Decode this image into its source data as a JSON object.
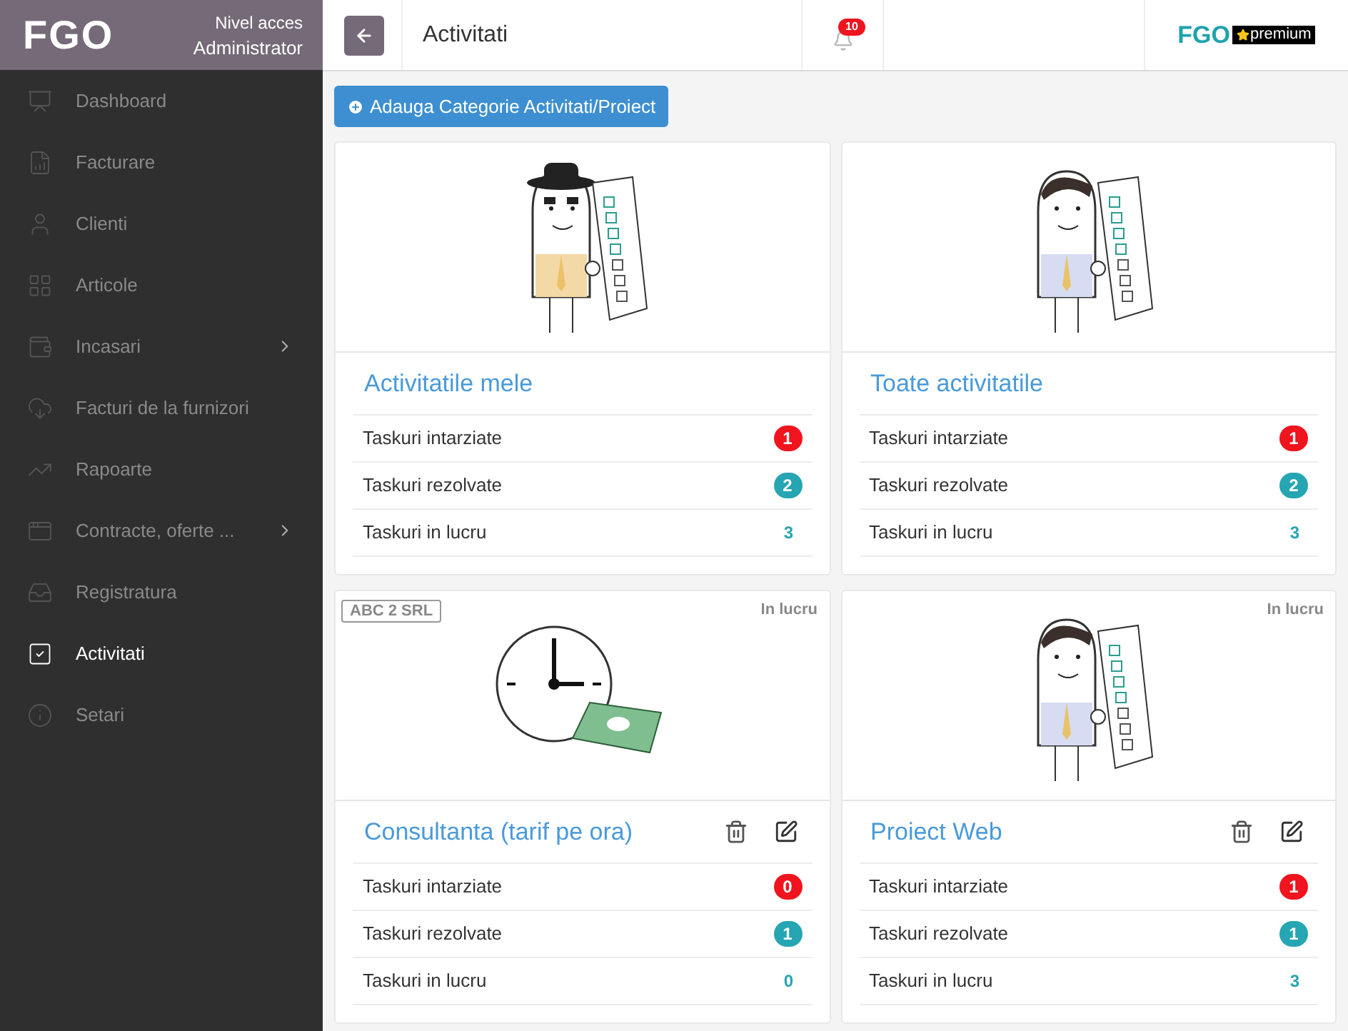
{
  "sidebar": {
    "brand": "FGO",
    "access_label": "Nivel acces",
    "access_role": "Administrator",
    "items": [
      {
        "label": "Dashboard",
        "selected": false,
        "expandable": false
      },
      {
        "label": "Facturare",
        "selected": false,
        "expandable": false
      },
      {
        "label": "Clienti",
        "selected": false,
        "expandable": false
      },
      {
        "label": "Articole",
        "selected": false,
        "expandable": false
      },
      {
        "label": "Incasari",
        "selected": false,
        "expandable": true
      },
      {
        "label": "Facturi de la furnizori",
        "selected": false,
        "expandable": false
      },
      {
        "label": "Rapoarte",
        "selected": false,
        "expandable": false
      },
      {
        "label": "Contracte, oferte ...",
        "selected": false,
        "expandable": true
      },
      {
        "label": "Registratura",
        "selected": false,
        "expandable": false
      },
      {
        "label": "Activitati",
        "selected": true,
        "expandable": false
      },
      {
        "label": "Setari",
        "selected": false,
        "expandable": false
      }
    ]
  },
  "topbar": {
    "title": "Activitati",
    "notifications": "10",
    "logo": "FGO",
    "plan": "premium"
  },
  "add_button": "Adauga Categorie Activitati/Proiect",
  "cards": [
    {
      "title": "Activitatile mele",
      "kind": "person-hat",
      "editable": false,
      "rows": [
        {
          "label": "Taskuri intarziate",
          "value": "1",
          "kind": "danger"
        },
        {
          "label": "Taskuri rezolvate",
          "value": "2",
          "kind": "info"
        },
        {
          "label": "Taskuri in lucru",
          "value": "3",
          "kind": "plain"
        }
      ]
    },
    {
      "title": "Toate activitatile",
      "kind": "person",
      "editable": false,
      "rows": [
        {
          "label": "Taskuri intarziate",
          "value": "1",
          "kind": "danger"
        },
        {
          "label": "Taskuri rezolvate",
          "value": "2",
          "kind": "info"
        },
        {
          "label": "Taskuri in lucru",
          "value": "3",
          "kind": "plain"
        }
      ]
    },
    {
      "title": "Consultanta (tarif pe ora)",
      "tag": "ABC 2 SRL",
      "status": "In lucru",
      "kind": "clock-money",
      "editable": true,
      "rows": [
        {
          "label": "Taskuri intarziate",
          "value": "0",
          "kind": "danger"
        },
        {
          "label": "Taskuri rezolvate",
          "value": "1",
          "kind": "info"
        },
        {
          "label": "Taskuri in lucru",
          "value": "0",
          "kind": "plain"
        }
      ]
    },
    {
      "title": "Proiect Web",
      "status": "In lucru",
      "kind": "person",
      "editable": true,
      "rows": [
        {
          "label": "Taskuri intarziate",
          "value": "1",
          "kind": "danger"
        },
        {
          "label": "Taskuri rezolvate",
          "value": "1",
          "kind": "info"
        },
        {
          "label": "Taskuri in lucru",
          "value": "3",
          "kind": "plain"
        }
      ]
    }
  ]
}
